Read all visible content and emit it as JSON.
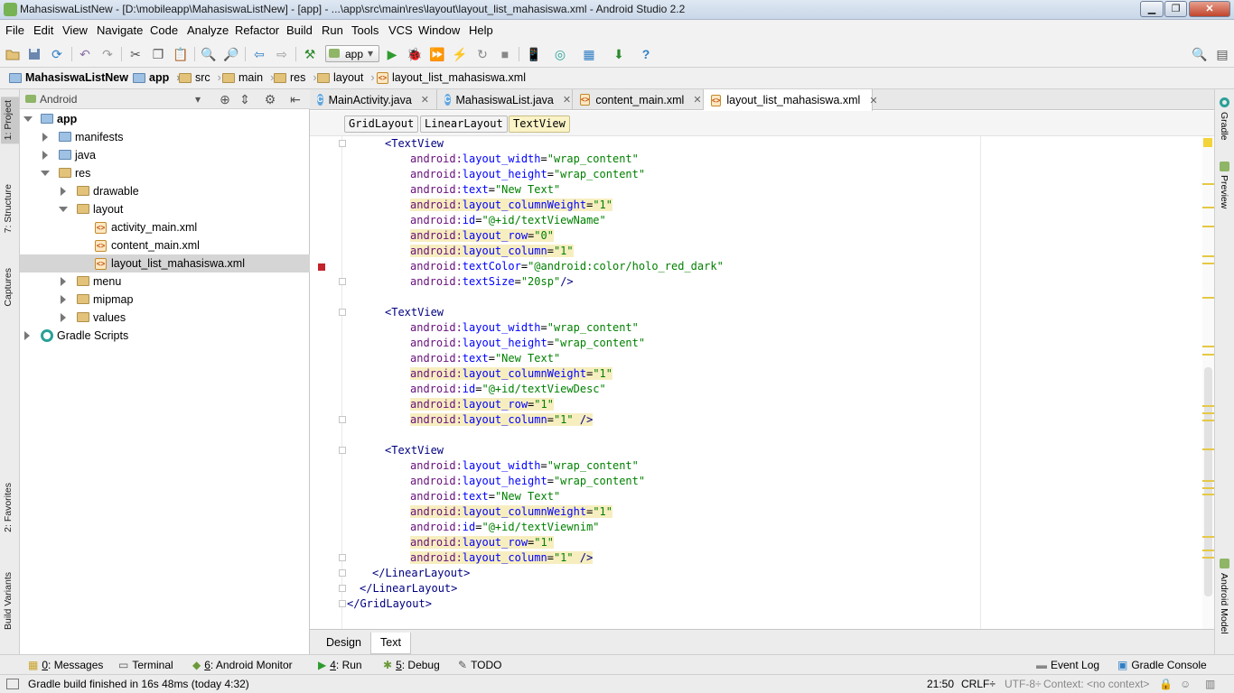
{
  "window": {
    "title": "MahasiswaListNew - [D:\\mobileapp\\MahasiswaListNew] - [app] - ...\\app\\src\\main\\res\\layout\\layout_list_mahasiswa.xml - Android Studio 2.2",
    "minimize": "▁",
    "maximize": "❐",
    "close": "✕"
  },
  "menu": [
    "File",
    "Edit",
    "View",
    "Navigate",
    "Code",
    "Analyze",
    "Refactor",
    "Build",
    "Run",
    "Tools",
    "VCS",
    "Window",
    "Help"
  ],
  "toolbar": {
    "run_config": "app"
  },
  "breadcrumb": [
    "MahasiswaListNew",
    "app",
    "src",
    "main",
    "res",
    "layout",
    "layout_list_mahasiswa.xml"
  ],
  "left_strip": [
    "1: Project",
    "7: Structure",
    "Captures",
    "2: Favorites",
    "Build Variants"
  ],
  "project": {
    "view_label": "Android",
    "tree": [
      {
        "label": "app",
        "depth": 0,
        "state": "open"
      },
      {
        "label": "manifests",
        "depth": 1,
        "state": "closed"
      },
      {
        "label": "java",
        "depth": 1,
        "state": "closed"
      },
      {
        "label": "res",
        "depth": 1,
        "state": "open"
      },
      {
        "label": "drawable",
        "depth": 2,
        "state": "closed"
      },
      {
        "label": "layout",
        "depth": 2,
        "state": "open"
      },
      {
        "label": "activity_main.xml",
        "depth": 3,
        "state": "file"
      },
      {
        "label": "content_main.xml",
        "depth": 3,
        "state": "file"
      },
      {
        "label": "layout_list_mahasiswa.xml",
        "depth": 3,
        "state": "file",
        "selected": true
      },
      {
        "label": "menu",
        "depth": 2,
        "state": "closed"
      },
      {
        "label": "mipmap",
        "depth": 2,
        "state": "closed"
      },
      {
        "label": "values",
        "depth": 2,
        "state": "closed"
      },
      {
        "label": "Gradle Scripts",
        "depth": 0,
        "state": "closed"
      }
    ]
  },
  "editor_tabs": [
    "MainActivity.java",
    "MahasiswaList.java",
    "content_main.xml",
    "layout_list_mahasiswa.xml"
  ],
  "xml_breadcrumb": [
    "GridLayout",
    "LinearLayout",
    "TextView"
  ],
  "code_lines": [
    {
      "indent": 6,
      "parts": [
        [
          "tag",
          "<TextView"
        ]
      ]
    },
    {
      "indent": 10,
      "parts": [
        [
          "ns",
          "android:"
        ],
        [
          "attr",
          "layout_width"
        ],
        [
          "plain",
          "="
        ],
        [
          "val",
          "\"wrap_content\""
        ]
      ]
    },
    {
      "indent": 10,
      "parts": [
        [
          "ns",
          "android:"
        ],
        [
          "attr",
          "layout_height"
        ],
        [
          "plain",
          "="
        ],
        [
          "val",
          "\"wrap_content\""
        ]
      ]
    },
    {
      "indent": 10,
      "parts": [
        [
          "ns",
          "android:"
        ],
        [
          "attr",
          "text"
        ],
        [
          "plain",
          "="
        ],
        [
          "val",
          "\"New Text\""
        ]
      ]
    },
    {
      "indent": 10,
      "hl": true,
      "parts": [
        [
          "ns",
          "android:"
        ],
        [
          "attr",
          "layout_columnWeight"
        ],
        [
          "plain",
          "="
        ],
        [
          "val",
          "\"1\""
        ]
      ]
    },
    {
      "indent": 10,
      "parts": [
        [
          "ns",
          "android:"
        ],
        [
          "attr",
          "id"
        ],
        [
          "plain",
          "="
        ],
        [
          "val",
          "\"@+id/textViewName\""
        ]
      ]
    },
    {
      "indent": 10,
      "hl": true,
      "parts": [
        [
          "ns",
          "android:"
        ],
        [
          "attr",
          "layout_row"
        ],
        [
          "plain",
          "="
        ],
        [
          "val",
          "\"0\""
        ]
      ]
    },
    {
      "indent": 10,
      "hl": true,
      "parts": [
        [
          "ns",
          "android:"
        ],
        [
          "attr",
          "layout_column"
        ],
        [
          "plain",
          "="
        ],
        [
          "val",
          "\"1\""
        ]
      ]
    },
    {
      "indent": 10,
      "parts": [
        [
          "ns",
          "android:"
        ],
        [
          "attr",
          "textColor"
        ],
        [
          "plain",
          "="
        ],
        [
          "val",
          "\"@android:color/holo_red_dark\""
        ]
      ]
    },
    {
      "indent": 10,
      "parts": [
        [
          "ns",
          "android:"
        ],
        [
          "attr",
          "textSize"
        ],
        [
          "plain",
          "="
        ],
        [
          "val",
          "\"20sp\""
        ],
        [
          "tag",
          "/>"
        ]
      ]
    },
    {
      "indent": 0,
      "parts": []
    },
    {
      "indent": 6,
      "parts": [
        [
          "tag",
          "<TextView"
        ]
      ]
    },
    {
      "indent": 10,
      "parts": [
        [
          "ns",
          "android:"
        ],
        [
          "attr",
          "layout_width"
        ],
        [
          "plain",
          "="
        ],
        [
          "val",
          "\"wrap_content\""
        ]
      ]
    },
    {
      "indent": 10,
      "parts": [
        [
          "ns",
          "android:"
        ],
        [
          "attr",
          "layout_height"
        ],
        [
          "plain",
          "="
        ],
        [
          "val",
          "\"wrap_content\""
        ]
      ]
    },
    {
      "indent": 10,
      "parts": [
        [
          "ns",
          "android:"
        ],
        [
          "attr",
          "text"
        ],
        [
          "plain",
          "="
        ],
        [
          "val",
          "\"New Text\""
        ]
      ]
    },
    {
      "indent": 10,
      "hl": true,
      "parts": [
        [
          "ns",
          "android:"
        ],
        [
          "attr",
          "layout_columnWeight"
        ],
        [
          "plain",
          "="
        ],
        [
          "val",
          "\"1\""
        ]
      ]
    },
    {
      "indent": 10,
      "parts": [
        [
          "ns",
          "android:"
        ],
        [
          "attr",
          "id"
        ],
        [
          "plain",
          "="
        ],
        [
          "val",
          "\"@+id/textViewDesc\""
        ]
      ]
    },
    {
      "indent": 10,
      "hl": true,
      "parts": [
        [
          "ns",
          "android:"
        ],
        [
          "attr",
          "layout_row"
        ],
        [
          "plain",
          "="
        ],
        [
          "val",
          "\"1\""
        ]
      ]
    },
    {
      "indent": 10,
      "hl": true,
      "parts": [
        [
          "ns",
          "android:"
        ],
        [
          "attr",
          "layout_column"
        ],
        [
          "plain",
          "="
        ],
        [
          "val",
          "\"1\""
        ],
        [
          "plain",
          " "
        ],
        [
          "tag",
          "/>"
        ]
      ]
    },
    {
      "indent": 0,
      "parts": []
    },
    {
      "indent": 6,
      "parts": [
        [
          "tag",
          "<TextView"
        ]
      ]
    },
    {
      "indent": 10,
      "parts": [
        [
          "ns",
          "android:"
        ],
        [
          "attr",
          "layout_width"
        ],
        [
          "plain",
          "="
        ],
        [
          "val",
          "\"wrap_content\""
        ]
      ]
    },
    {
      "indent": 10,
      "parts": [
        [
          "ns",
          "android:"
        ],
        [
          "attr",
          "layout_height"
        ],
        [
          "plain",
          "="
        ],
        [
          "val",
          "\"wrap_content\""
        ]
      ]
    },
    {
      "indent": 10,
      "parts": [
        [
          "ns",
          "android:"
        ],
        [
          "attr",
          "text"
        ],
        [
          "plain",
          "="
        ],
        [
          "val",
          "\"New Text\""
        ]
      ]
    },
    {
      "indent": 10,
      "hl": true,
      "parts": [
        [
          "ns",
          "android:"
        ],
        [
          "attr",
          "layout_columnWeight"
        ],
        [
          "plain",
          "="
        ],
        [
          "val",
          "\"1\""
        ]
      ]
    },
    {
      "indent": 10,
      "parts": [
        [
          "ns",
          "android:"
        ],
        [
          "attr",
          "id"
        ],
        [
          "plain",
          "="
        ],
        [
          "val",
          "\"@+id/textViewnim\""
        ]
      ]
    },
    {
      "indent": 10,
      "hl": true,
      "parts": [
        [
          "ns",
          "android:"
        ],
        [
          "attr",
          "layout_row"
        ],
        [
          "plain",
          "="
        ],
        [
          "val",
          "\"1\""
        ]
      ]
    },
    {
      "indent": 10,
      "hl": true,
      "parts": [
        [
          "ns",
          "android:"
        ],
        [
          "attr",
          "layout_column"
        ],
        [
          "plain",
          "="
        ],
        [
          "val",
          "\"1\""
        ],
        [
          "plain",
          " "
        ],
        [
          "tag",
          "/>"
        ]
      ]
    },
    {
      "indent": 4,
      "parts": [
        [
          "tag",
          "</LinearLayout>"
        ]
      ]
    },
    {
      "indent": 2,
      "parts": [
        [
          "tag",
          "</LinearLayout>"
        ]
      ]
    },
    {
      "indent": 0,
      "parts": [
        [
          "tag",
          "</GridLayout>"
        ]
      ]
    }
  ],
  "bottom_editor_tabs": [
    "Design",
    "Text"
  ],
  "right_strip": [
    "Gradle",
    "Preview",
    "Android Model"
  ],
  "tool_windows_left": [
    {
      "key": "0",
      "label": ": Messages"
    },
    {
      "key": "",
      "label": "Terminal"
    },
    {
      "key": "6",
      "label": ": Android Monitor"
    },
    {
      "key": "4",
      "label": ": Run"
    },
    {
      "key": "5",
      "label": ": Debug"
    },
    {
      "key": "",
      "label": "TODO"
    }
  ],
  "tool_windows_right": [
    "Event Log",
    "Gradle Console"
  ],
  "status": {
    "message": "Gradle build finished in 16s 48ms (today 4:32)",
    "position": "21:50",
    "line_sep": "CRLF÷",
    "encoding": "UTF-8÷",
    "context": "Context: <no context>"
  }
}
